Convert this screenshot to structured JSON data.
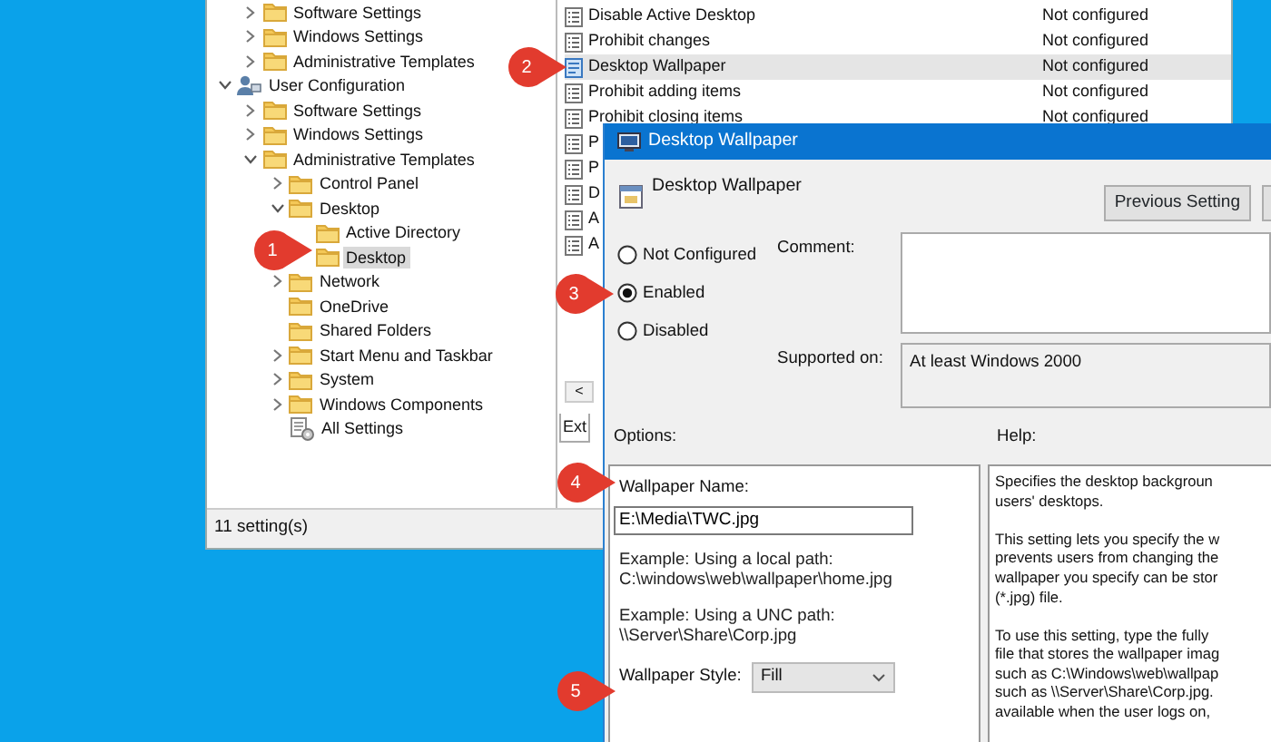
{
  "tree": {
    "continued_items": [
      {
        "label": "Software Settings",
        "kind": "folder",
        "expandable": true,
        "expanded": false,
        "selected": false
      },
      {
        "label": "Windows Settings",
        "kind": "folder",
        "expandable": true,
        "expanded": false,
        "selected": false
      },
      {
        "label": "Administrative Templates",
        "kind": "folder",
        "expandable": true,
        "expanded": false,
        "selected": false
      }
    ],
    "items": [
      {
        "label": "User Configuration",
        "kind": "user",
        "expandable": true,
        "expanded": true,
        "selected": false,
        "children": [
          {
            "label": "Software Settings",
            "kind": "folder",
            "expandable": true,
            "expanded": false,
            "selected": false
          },
          {
            "label": "Windows Settings",
            "kind": "folder",
            "expandable": true,
            "expanded": false,
            "selected": false
          },
          {
            "label": "Administrative Templates",
            "kind": "folder",
            "expandable": true,
            "expanded": true,
            "selected": false,
            "children": [
              {
                "label": "Control Panel",
                "kind": "folder",
                "expandable": true,
                "expanded": false,
                "selected": false
              },
              {
                "label": "Desktop",
                "kind": "folder",
                "expandable": true,
                "expanded": true,
                "selected": false,
                "children": [
                  {
                    "label": "Active Directory",
                    "kind": "folder",
                    "expandable": false,
                    "selected": false
                  },
                  {
                    "label": "Desktop",
                    "kind": "folder",
                    "expandable": false,
                    "selected": true
                  }
                ]
              },
              {
                "label": "Network",
                "kind": "folder",
                "expandable": true,
                "expanded": false,
                "selected": false
              },
              {
                "label": "OneDrive",
                "kind": "folder",
                "expandable": false,
                "selected": false
              },
              {
                "label": "Shared Folders",
                "kind": "folder",
                "expandable": false,
                "selected": false
              },
              {
                "label": "Start Menu and Taskbar",
                "kind": "folder",
                "expandable": true,
                "expanded": false,
                "selected": false
              },
              {
                "label": "System",
                "kind": "folder",
                "expandable": true,
                "expanded": false,
                "selected": false
              },
              {
                "label": "Windows Components",
                "kind": "folder",
                "expandable": true,
                "expanded": false,
                "selected": false
              },
              {
                "label": "All Settings",
                "kind": "settings",
                "expandable": false,
                "selected": false
              }
            ]
          }
        ]
      }
    ]
  },
  "status_bar": {
    "text": "11 setting(s)"
  },
  "settings_list": {
    "rows": [
      {
        "name": "Disable Active Desktop",
        "state": "Not configured",
        "selected": false
      },
      {
        "name": "Prohibit changes",
        "state": "Not configured",
        "selected": false
      },
      {
        "name": "Desktop Wallpaper",
        "state": "Not configured",
        "selected": true
      },
      {
        "name": "Prohibit adding items",
        "state": "Not configured",
        "selected": false
      },
      {
        "name": "Prohibit closing items",
        "state": "Not configured",
        "selected": false
      },
      {
        "name": "P",
        "selected": false
      },
      {
        "name": "P",
        "selected": false
      },
      {
        "name": "D",
        "selected": false
      },
      {
        "name": "A",
        "selected": false
      },
      {
        "name": "A",
        "selected": false
      }
    ],
    "scroll_arrow": "<",
    "tab": "Ext"
  },
  "dialog": {
    "title": "Desktop Wallpaper",
    "heading": "Desktop Wallpaper",
    "previous_button": "Previous Setting",
    "options": [
      {
        "label": "Not Configured",
        "selected": false
      },
      {
        "label": "Enabled",
        "selected": true
      },
      {
        "label": "Disabled",
        "selected": false
      }
    ],
    "comment_label": "Comment:",
    "supported_label": "Supported on:",
    "supported_value": "At least Windows 2000",
    "options_label": "Options:",
    "help_label": "Help:",
    "options_panel": {
      "name_label": "Wallpaper Name:",
      "name_value": "E:\\Media\\TWC.jpg",
      "examples": [
        {
          "caption": "Example: Using a local path:",
          "path": "C:\\windows\\web\\wallpaper\\home.jpg"
        },
        {
          "caption": "Example: Using a UNC path:",
          "path": "\\\\Server\\Share\\Corp.jpg"
        }
      ],
      "style_label": "Wallpaper Style:",
      "style_value": "Fill"
    },
    "help_paragraphs": [
      [
        "Specifies the desktop backgroun",
        "users' desktops."
      ],
      [
        "This setting lets you specify the w",
        "prevents users from changing the",
        "wallpaper you specify can be stor",
        "(*.jpg) file."
      ],
      [
        "To use this setting, type the fully",
        "file that stores the wallpaper imag",
        "such as C:\\Windows\\web\\wallpap",
        "such as \\\\Server\\Share\\Corp.jpg.",
        "available when the user logs on,"
      ]
    ]
  },
  "callouts": [
    {
      "number": "1"
    },
    {
      "number": "2"
    },
    {
      "number": "3"
    },
    {
      "number": "4"
    },
    {
      "number": "5"
    }
  ]
}
